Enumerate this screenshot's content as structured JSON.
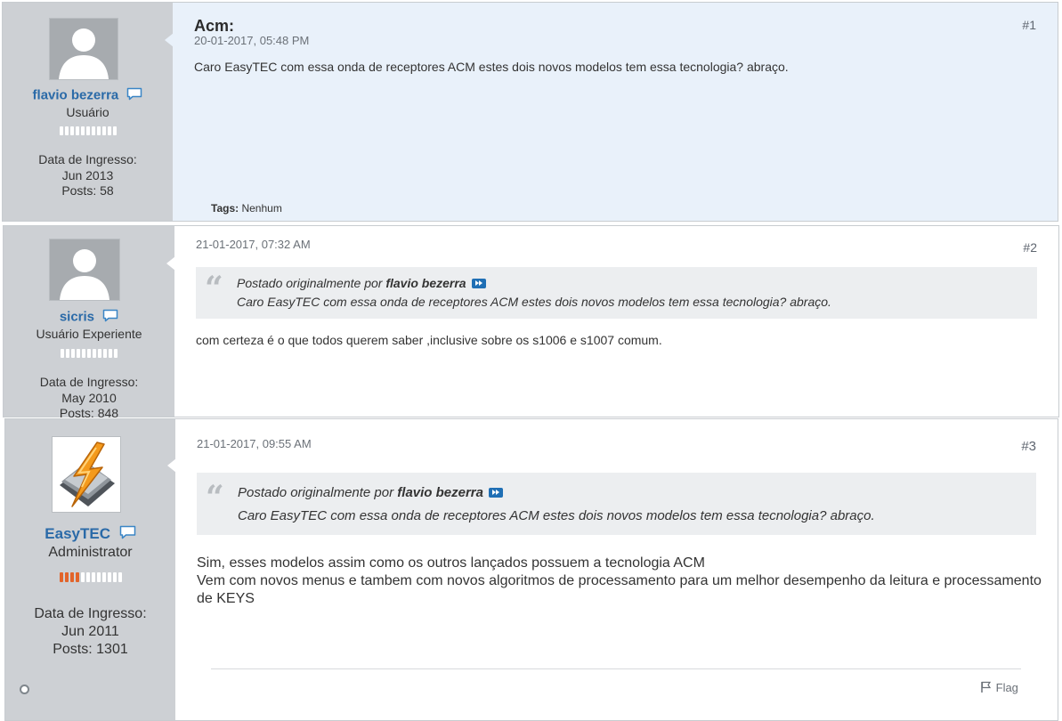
{
  "colors": {
    "sidebar_bg": "#cdd0d4",
    "first_post_bg": "#e9f1fa",
    "username": "#2a6aa8",
    "reputation_on": "#e2642a"
  },
  "posts": [
    {
      "number": "#1",
      "title": "Acm:",
      "date": "20-01-2017, 05:48 PM",
      "body": "Caro EasyTEC com essa onda de receptores ACM estes dois novos modelos tem essa tecnologia? abraço.",
      "tags_label": "Tags:",
      "tags_value": "Nenhum",
      "author": {
        "username": "flavio bezerra",
        "user_title": "Usuário",
        "avatar": "default-avatar-icon",
        "reputation_level": 0,
        "join_label": "Data de Ingresso:",
        "join_date": "Jun 2013",
        "posts_label": "Posts:",
        "posts_count": "58"
      }
    },
    {
      "number": "#2",
      "date": "21-01-2017, 07:32 AM",
      "quote": {
        "intro": "Postado originalmente por",
        "author": "flavio bezerra",
        "text": "Caro EasyTEC com essa onda de receptores ACM estes dois novos modelos tem essa tecnologia? abraço."
      },
      "body": "com certeza é o que todos querem saber ,inclusive sobre os s1006 e s1007 comum.",
      "author": {
        "username": "sicris",
        "user_title": "Usuário Experiente",
        "avatar": "default-avatar-icon",
        "reputation_level": 0,
        "join_label": "Data de Ingresso:",
        "join_date": "May 2010",
        "posts_label": "Posts:",
        "posts_count": "848"
      }
    },
    {
      "number": "#3",
      "date": "21-01-2017, 09:55 AM",
      "quote": {
        "intro": "Postado originalmente por",
        "author": "flavio bezerra",
        "text": "Caro EasyTEC com essa onda de receptores ACM estes dois novos modelos tem essa tecnologia? abraço."
      },
      "body_lines": [
        "Sim, esses modelos assim como os outros lançados possuem a tecnologia ACM",
        "Vem com novos menus e tambem com novos algoritmos de processamento para um melhor desempenho da leitura e processamento de KEYS"
      ],
      "flag_label": "Flag",
      "author": {
        "username": "EasyTEC",
        "user_title": "Administrator",
        "avatar": "lightning-logo-icon",
        "reputation_level": 4,
        "join_label": "Data de Ingresso:",
        "join_date": "Jun 2011",
        "posts_label": "Posts:",
        "posts_count": "1301"
      }
    }
  ]
}
